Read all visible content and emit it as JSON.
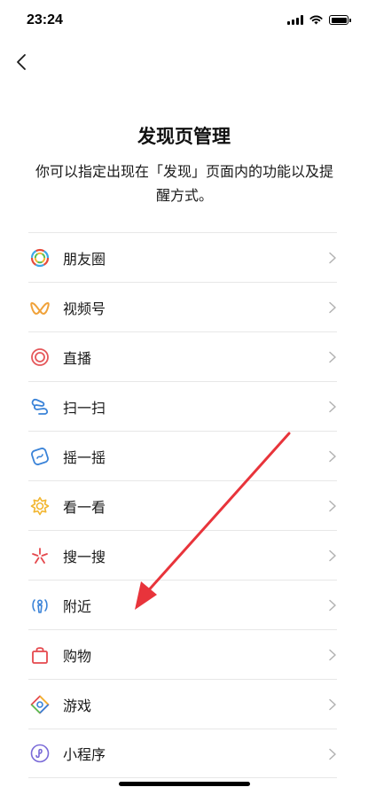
{
  "status_bar": {
    "time": "23:24"
  },
  "page": {
    "title": "发现页管理",
    "description": "你可以指定出现在「发现」页面内的功能以及提醒方式。"
  },
  "items": [
    {
      "label": "朋友圈",
      "icon": "moments-icon"
    },
    {
      "label": "视频号",
      "icon": "channels-icon"
    },
    {
      "label": "直播",
      "icon": "live-icon"
    },
    {
      "label": "扫一扫",
      "icon": "scan-icon"
    },
    {
      "label": "摇一摇",
      "icon": "shake-icon"
    },
    {
      "label": "看一看",
      "icon": "top-stories-icon"
    },
    {
      "label": "搜一搜",
      "icon": "search-icon"
    },
    {
      "label": "附近",
      "icon": "nearby-icon"
    },
    {
      "label": "购物",
      "icon": "shopping-icon"
    },
    {
      "label": "游戏",
      "icon": "games-icon"
    },
    {
      "label": "小程序",
      "icon": "mini-programs-icon"
    }
  ],
  "annotation": {
    "color": "#e8343b"
  }
}
